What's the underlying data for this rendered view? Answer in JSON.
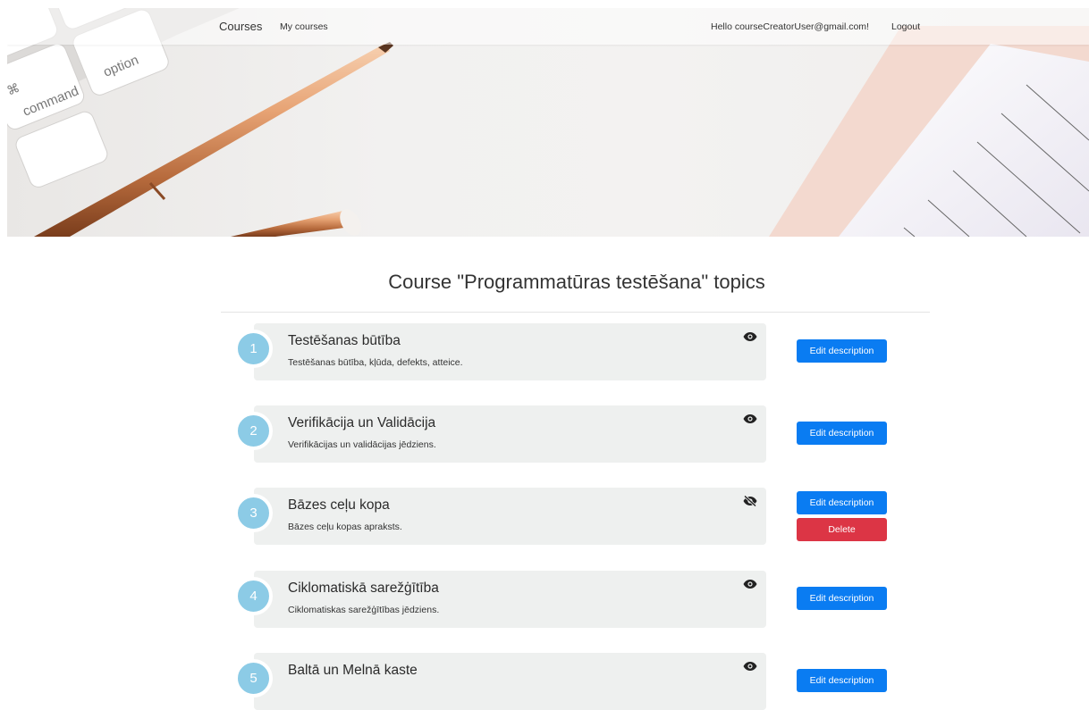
{
  "navbar": {
    "brand": "Courses",
    "my_courses": "My courses",
    "greeting": "Hello courseCreatorUser@gmail.com!",
    "logout": "Logout"
  },
  "hero": {
    "keyboard_key_1": "option",
    "keyboard_key_2": "command",
    "keyboard_key_symbol": "⌘"
  },
  "page": {
    "title": "Course \"Programmatūras testēšana\" topics"
  },
  "topics": [
    {
      "number": "1",
      "title": "Testēšanas būtība",
      "description": "Testēšanas būtība, kļūda, defekts, atteice.",
      "visibility_icon": "eye-icon",
      "edit_label": "Edit description"
    },
    {
      "number": "2",
      "title": "Verifikācija un Validācija",
      "description": "Verifikācijas un validācijas jēdziens.",
      "visibility_icon": "eye-icon",
      "edit_label": "Edit description"
    },
    {
      "number": "3",
      "title": "Bāzes ceļu kopa",
      "description": "Bāzes ceļu kopas apraksts.",
      "visibility_icon": "eye-slash-icon",
      "edit_label": "Edit description",
      "delete_label": "Delete"
    },
    {
      "number": "4",
      "title": "Ciklomatiskā sarežģītība",
      "description": "Ciklomatiskas sarežģītības jēdziens.",
      "visibility_icon": "eye-icon",
      "edit_label": "Edit description"
    },
    {
      "number": "5",
      "title": "Baltā un Melnā kaste",
      "description": "",
      "visibility_icon": "eye-icon",
      "edit_label": "Edit description"
    }
  ],
  "colors": {
    "primary": "#0a7cf2",
    "danger": "#dc3545",
    "circle": "#8ccbe6",
    "card_bg": "#eef0ef"
  }
}
